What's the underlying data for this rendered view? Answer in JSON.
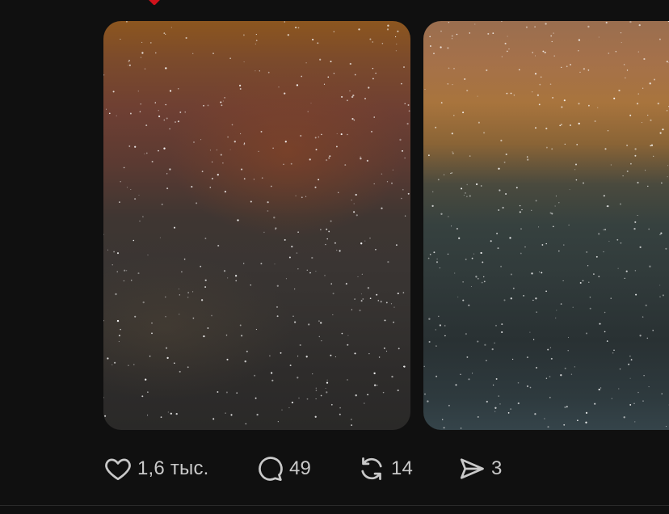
{
  "post": {
    "media": [
      {
        "name": "photo-1",
        "colors": [
          "#8c561f",
          "#6e3f33",
          "#3a3533",
          "#2a2928"
        ]
      },
      {
        "name": "photo-2",
        "colors": [
          "#9a6e4f",
          "#a8743d",
          "#313b3b",
          "#35444a"
        ]
      }
    ],
    "actions": {
      "like": {
        "icon": "heart-icon",
        "count": "1,6 тыс."
      },
      "comment": {
        "icon": "speech-bubble-icon",
        "count": "49"
      },
      "repost": {
        "icon": "repost-icon",
        "count": "14"
      },
      "share": {
        "icon": "paper-plane-icon",
        "count": "3"
      }
    }
  },
  "colors": {
    "background": "#101010",
    "icon": "#c9c9c9",
    "indicator": "#d0121b"
  }
}
